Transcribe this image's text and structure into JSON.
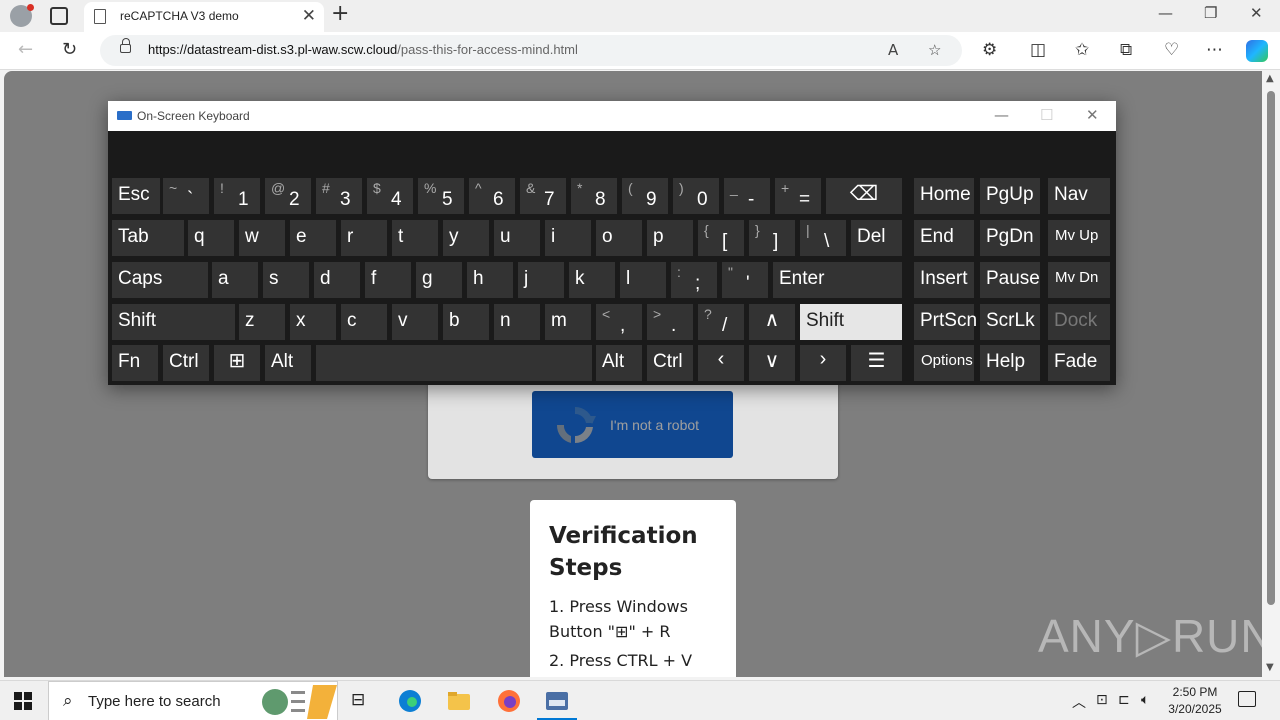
{
  "browser": {
    "tab_title": "reCAPTCHA V3 demo",
    "url_host": "https://datastream-dist.s3.pl-waw.scw.cloud",
    "url_path": "/pass-this-for-access-mind.html"
  },
  "page": {
    "captcha_label": "I'm not a robot",
    "steps_title": "Verification Steps",
    "steps": [
      "1. Press Windows Button \"⊞\" + R",
      "2. Press CTRL + V"
    ],
    "watermark": "ANY▷RUN"
  },
  "osk": {
    "title": "On-Screen Keyboard",
    "rows": [
      [
        {
          "id": "esc",
          "label": "Esc"
        },
        {
          "id": "backtick",
          "sym": "~",
          "dig": "`"
        },
        {
          "id": "1",
          "sym": "!",
          "dig": "1"
        },
        {
          "id": "2",
          "sym": "@",
          "dig": "2"
        },
        {
          "id": "3",
          "sym": "#",
          "dig": "3"
        },
        {
          "id": "4",
          "sym": "$",
          "dig": "4"
        },
        {
          "id": "5",
          "sym": "%",
          "dig": "5"
        },
        {
          "id": "6",
          "sym": "^",
          "dig": "6"
        },
        {
          "id": "7",
          "sym": "&",
          "dig": "7"
        },
        {
          "id": "8",
          "sym": "*",
          "dig": "8"
        },
        {
          "id": "9",
          "sym": "(",
          "dig": "9"
        },
        {
          "id": "0",
          "sym": ")",
          "dig": "0"
        },
        {
          "id": "minus",
          "sym": "_",
          "dig": "-"
        },
        {
          "id": "equals",
          "sym": "+",
          "dig": "="
        },
        {
          "id": "backspace",
          "glyph": "⌫"
        },
        {
          "id": "home",
          "label": "Home"
        },
        {
          "id": "pgup",
          "label": "PgUp"
        },
        {
          "id": "nav",
          "label": "Nav"
        }
      ],
      [
        {
          "id": "tab",
          "label": "Tab"
        },
        {
          "id": "q",
          "label": "q"
        },
        {
          "id": "w",
          "label": "w"
        },
        {
          "id": "e",
          "label": "e"
        },
        {
          "id": "r",
          "label": "r"
        },
        {
          "id": "t",
          "label": "t"
        },
        {
          "id": "y",
          "label": "y"
        },
        {
          "id": "u",
          "label": "u"
        },
        {
          "id": "i",
          "label": "i"
        },
        {
          "id": "o",
          "label": "o"
        },
        {
          "id": "p",
          "label": "p"
        },
        {
          "id": "lbracket",
          "sym": "{",
          "dig": "["
        },
        {
          "id": "rbracket",
          "sym": "}",
          "dig": "]"
        },
        {
          "id": "backslash",
          "sym": "|",
          "dig": "\\"
        },
        {
          "id": "del",
          "label": "Del"
        },
        {
          "id": "end",
          "label": "End"
        },
        {
          "id": "pgdn",
          "label": "PgDn"
        },
        {
          "id": "mvup",
          "label": "Mv Up",
          "small": true
        }
      ],
      [
        {
          "id": "caps",
          "label": "Caps"
        },
        {
          "id": "a",
          "label": "a"
        },
        {
          "id": "s",
          "label": "s"
        },
        {
          "id": "d",
          "label": "d"
        },
        {
          "id": "f",
          "label": "f"
        },
        {
          "id": "g",
          "label": "g"
        },
        {
          "id": "h",
          "label": "h"
        },
        {
          "id": "j",
          "label": "j"
        },
        {
          "id": "k",
          "label": "k"
        },
        {
          "id": "l",
          "label": "l"
        },
        {
          "id": "semicolon",
          "sym": ":",
          "dig": ";"
        },
        {
          "id": "quote",
          "sym": "\"",
          "dig": "'"
        },
        {
          "id": "enter",
          "label": "Enter"
        },
        {
          "id": "insert",
          "label": "Insert"
        },
        {
          "id": "pause",
          "label": "Pause"
        },
        {
          "id": "mvdn",
          "label": "Mv Dn",
          "small": true
        }
      ],
      [
        {
          "id": "lshift",
          "label": "Shift"
        },
        {
          "id": "z",
          "label": "z"
        },
        {
          "id": "x",
          "label": "x"
        },
        {
          "id": "c",
          "label": "c"
        },
        {
          "id": "v",
          "label": "v"
        },
        {
          "id": "b",
          "label": "b"
        },
        {
          "id": "n",
          "label": "n"
        },
        {
          "id": "m",
          "label": "m"
        },
        {
          "id": "comma",
          "sym": "<",
          "dig": ","
        },
        {
          "id": "period",
          "sym": ">",
          "dig": "."
        },
        {
          "id": "slash",
          "sym": "?",
          "dig": "/"
        },
        {
          "id": "up",
          "glyph": "∧"
        },
        {
          "id": "rshift",
          "label": "Shift",
          "pressed": true
        },
        {
          "id": "prtscn",
          "label": "PrtScn"
        },
        {
          "id": "scrlk",
          "label": "ScrLk"
        },
        {
          "id": "dock",
          "label": "Dock",
          "dim": true
        }
      ],
      [
        {
          "id": "fn",
          "label": "Fn"
        },
        {
          "id": "lctrl",
          "label": "Ctrl"
        },
        {
          "id": "win",
          "glyph": "⊞"
        },
        {
          "id": "lalt",
          "label": "Alt"
        },
        {
          "id": "space",
          "label": ""
        },
        {
          "id": "ralt",
          "label": "Alt"
        },
        {
          "id": "rctrl",
          "label": "Ctrl"
        },
        {
          "id": "left",
          "glyph": "‹"
        },
        {
          "id": "down",
          "glyph": "∨"
        },
        {
          "id": "right",
          "glyph": "›"
        },
        {
          "id": "menu",
          "glyph": "☰"
        },
        {
          "id": "options",
          "label": "Options",
          "small": true
        },
        {
          "id": "help",
          "label": "Help"
        },
        {
          "id": "fade",
          "label": "Fade"
        }
      ]
    ]
  },
  "taskbar": {
    "search_placeholder": "Type here to search",
    "time": "2:50 PM",
    "date": "3/20/2025"
  },
  "colors": {
    "captcha_button": "#1a73e8",
    "osk_key": "#333333",
    "osk_pressed": "#e6e6e6"
  }
}
